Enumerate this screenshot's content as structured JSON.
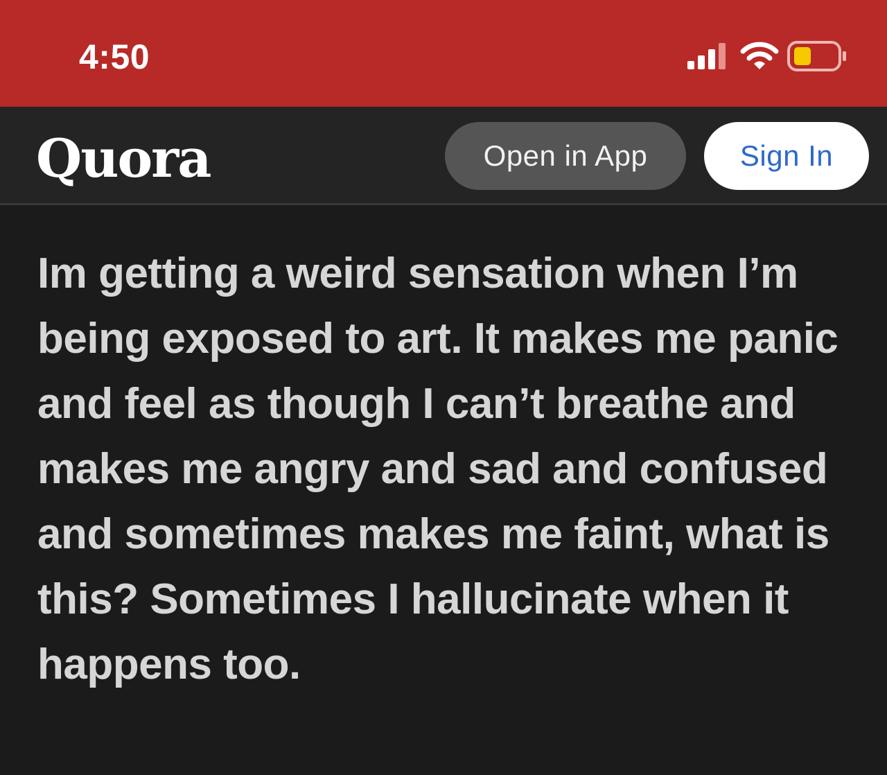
{
  "status_bar": {
    "time": "4:50",
    "icons": [
      "signal-icon",
      "wifi-icon",
      "battery-icon"
    ],
    "battery_color": "#f7c900",
    "background": "#b72a27"
  },
  "header": {
    "logo": "Quora",
    "open_app_label": "Open in App",
    "sign_in_label": "Sign In",
    "sign_in_color": "#2e69c8"
  },
  "question": {
    "title": "Im getting a weird sensation when I’m being exposed to art. It makes me panic and feel as though I can’t breathe and makes me angry and sad and confused and sometimes makes me faint, what is this? Sometimes I hallucinate when it happens too."
  }
}
